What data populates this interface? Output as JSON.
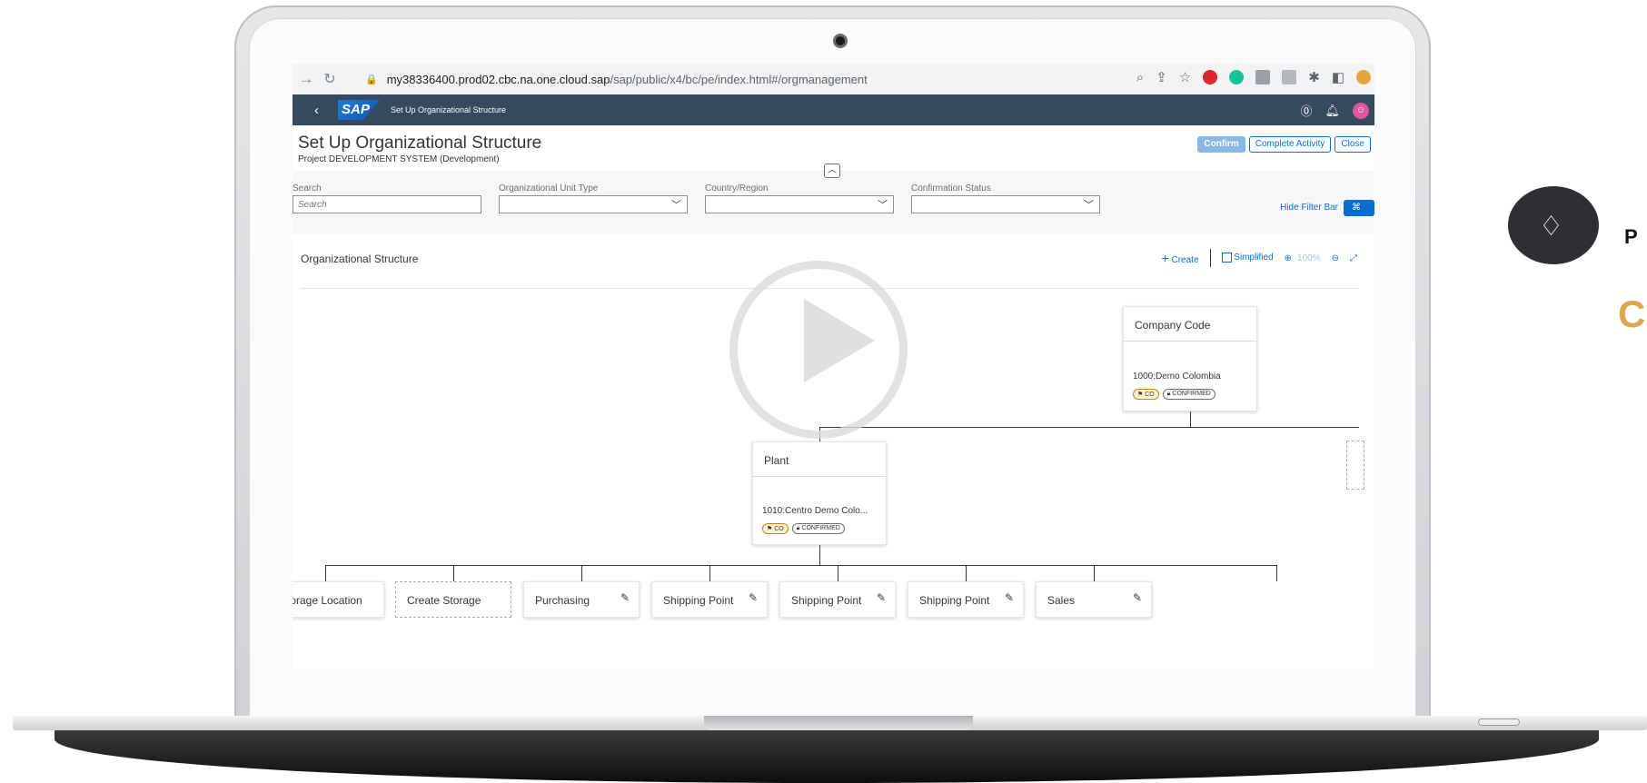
{
  "browser": {
    "url_host": "my38336400.prod02.cbc.na.one.cloud.sap",
    "url_path": "/sap/public/x4/bc/pe/index.html#/orgmanagement"
  },
  "shellbar": {
    "logo": "SAP",
    "title": "Set Up Organizational Structure"
  },
  "page": {
    "title": "Set Up Organizational Structure",
    "subtitle": "Project DEVELOPMENT SYSTEM (Development)",
    "buttons": {
      "confirm": "Confirm",
      "complete_activity": "Complete Activity",
      "close": "Close"
    }
  },
  "filters": {
    "search_label": "Search",
    "search_placeholder": "Search",
    "org_unit_label": "Organizational Unit Type",
    "country_label": "Country/Region",
    "status_label": "Confirmation Status",
    "hide_filter": "Hide Filter Bar"
  },
  "panel": {
    "title": "Organizational Structure",
    "create": "Create",
    "simplified": "Simplified",
    "zoom": "100%"
  },
  "nodes": {
    "company_code": {
      "title": "Company Code",
      "value": "1000:Demo Colombia",
      "tag_country": "CO",
      "tag_status": "CONFIRMED"
    },
    "plant": {
      "title": "Plant",
      "value": "1010:Centro Demo Colo...",
      "tag_country": "CO",
      "tag_status": "CONFIRMED"
    }
  },
  "bottom_nodes": [
    {
      "label": "Storage Location"
    },
    {
      "label": "Create Storage"
    },
    {
      "label": "Purchasing"
    },
    {
      "label": "Shipping Point"
    },
    {
      "label": "Shipping Point"
    },
    {
      "label": "Shipping Point"
    },
    {
      "label": "Sales"
    }
  ],
  "side": {
    "p_text": "P",
    "c_text": "C"
  },
  "colors": {
    "shell": "#354a5f",
    "accent": "#0a6ed1",
    "side_accent": "#e0a54f"
  },
  "icons": [
    "back-arrow-icon",
    "reload-icon",
    "lock-icon",
    "zoom-in-icon",
    "zoom-out-icon",
    "fullscreen-icon",
    "help-icon",
    "bell-icon",
    "diamond-icon",
    "play-icon"
  ]
}
